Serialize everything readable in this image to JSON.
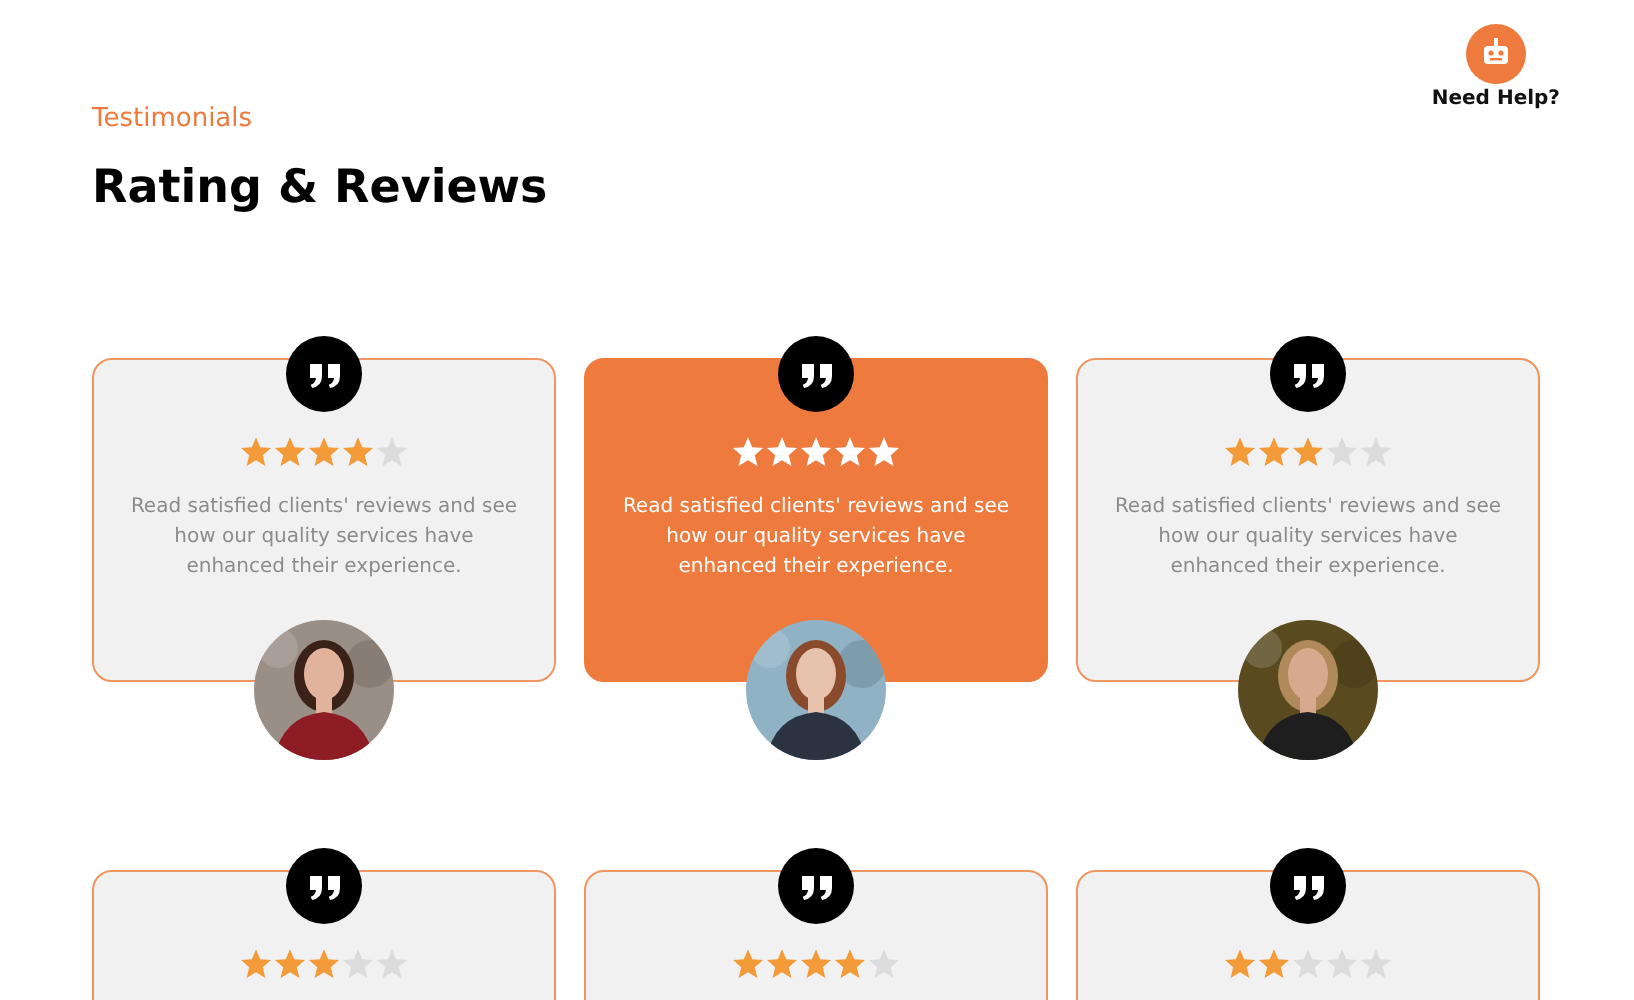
{
  "help": {
    "label": "Need Help?"
  },
  "section": {
    "eyebrow": "Testimonials",
    "title": "Rating & Reviews"
  },
  "reviews": [
    {
      "selected": false,
      "stars": 4,
      "text": "Read satisfied clients' reviews and see how our quality services have enhanced their experience."
    },
    {
      "selected": true,
      "stars": 5,
      "text": "Read satisfied clients' reviews and see how our quality services have enhanced their experience."
    },
    {
      "selected": false,
      "stars": 3,
      "text": "Read satisfied clients' reviews and see how our quality services have enhanced their experience."
    },
    {
      "selected": false,
      "stars": 3
    },
    {
      "selected": false,
      "stars": 4
    },
    {
      "selected": false,
      "stars": 2
    }
  ]
}
